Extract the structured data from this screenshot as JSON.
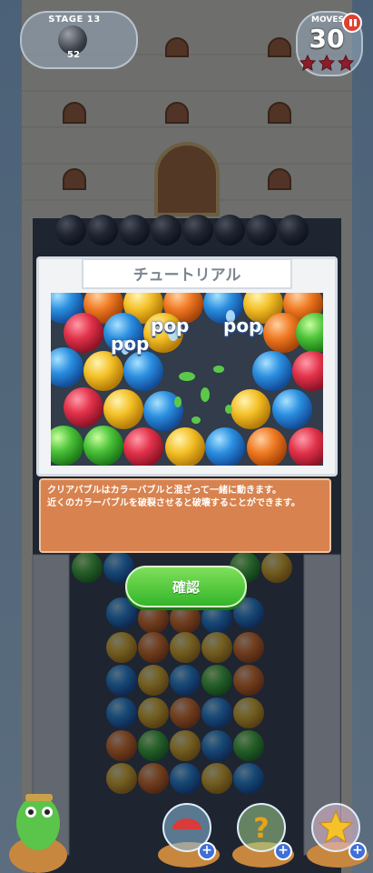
{
  "hud": {
    "stage_label": "STAGE 13",
    "stage_count": "52",
    "moves_label": "MOVES",
    "moves_value": "30",
    "stars_earned": 0,
    "stars_total": 3,
    "pause_icon": "pause-icon"
  },
  "tutorial": {
    "title": "チュートリアル",
    "pop_words": [
      "pop",
      "pop",
      "pop"
    ],
    "description": "クリアバブルはカラーバブルと混ざって一緒に動きます。\n近くのカラーバブルを破裂させると破壊することができます。",
    "confirm_label": "確認"
  },
  "boosters": [
    {
      "icon": "umbrella-bubble-icon",
      "addable": true
    },
    {
      "icon": "question-bubble-icon",
      "addable": true
    },
    {
      "icon": "star-bubble-icon",
      "addable": true
    }
  ],
  "character": {
    "icon": "green-dragon-icon"
  },
  "colors": {
    "confirm_green": "#34b52a",
    "info_orange": "#d8834f",
    "title_gray": "#7c858f",
    "pause_red": "#e0402e",
    "star_red": "#8b1e2a"
  }
}
